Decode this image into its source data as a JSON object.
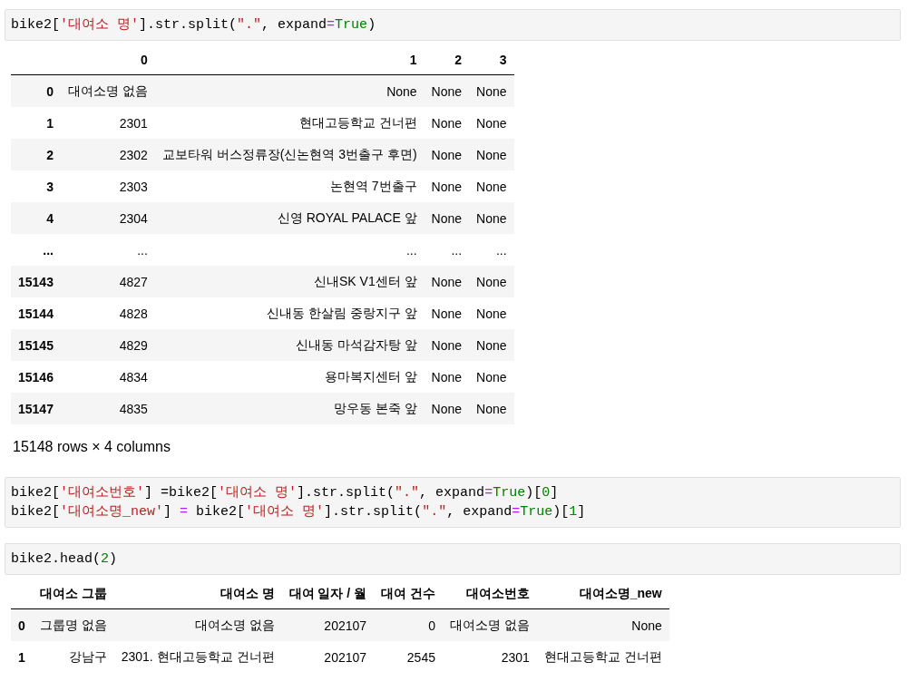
{
  "cells": [
    {
      "kind": "code",
      "lines": [
        [
          {
            "text": "bike2[",
            "kind": "plain"
          },
          {
            "text": "'대여소 명'",
            "kind": "string"
          },
          {
            "text": "].str.split(",
            "kind": "plain"
          },
          {
            "text": "\".\"",
            "kind": "string"
          },
          {
            "text": ", expand",
            "kind": "plain"
          },
          {
            "text": "=",
            "kind": "operator"
          },
          {
            "text": "True",
            "kind": "keyword"
          },
          {
            "text": ")",
            "kind": "plain"
          }
        ]
      ]
    },
    {
      "kind": "table",
      "columns": [
        "0",
        "1",
        "2",
        "3"
      ],
      "rows": [
        {
          "index": "0",
          "cells": [
            "대여소명 없음",
            "None",
            "None",
            "None"
          ]
        },
        {
          "index": "1",
          "cells": [
            "2301",
            "현대고등학교 건너편",
            "None",
            "None"
          ]
        },
        {
          "index": "2",
          "cells": [
            "2302",
            "교보타워 버스정류장(신논현역 3번출구 후면)",
            "None",
            "None"
          ]
        },
        {
          "index": "3",
          "cells": [
            "2303",
            "논현역 7번출구",
            "None",
            "None"
          ]
        },
        {
          "index": "4",
          "cells": [
            "2304",
            "신영 ROYAL PALACE 앞",
            "None",
            "None"
          ]
        },
        {
          "index": "...",
          "cells": [
            "...",
            "...",
            "...",
            "..."
          ]
        },
        {
          "index": "15143",
          "cells": [
            "4827",
            "신내SK V1센터 앞",
            "None",
            "None"
          ]
        },
        {
          "index": "15144",
          "cells": [
            "4828",
            "신내동 한살림 중랑지구 앞",
            "None",
            "None"
          ]
        },
        {
          "index": "15145",
          "cells": [
            "4829",
            "신내동 마석감자탕 앞",
            "None",
            "None"
          ]
        },
        {
          "index": "15146",
          "cells": [
            "4834",
            "용마복지센터 앞",
            "None",
            "None"
          ]
        },
        {
          "index": "15147",
          "cells": [
            "4835",
            "망우동 본죽 앞",
            "None",
            "None"
          ]
        }
      ]
    },
    {
      "kind": "text",
      "text": "15148 rows × 4 columns"
    },
    {
      "kind": "code",
      "lines": [
        [
          {
            "text": "bike2[",
            "kind": "plain"
          },
          {
            "text": "'대여소번호'",
            "kind": "string"
          },
          {
            "text": "] =bike2[",
            "kind": "plain"
          },
          {
            "text": "'대여소 명'",
            "kind": "string"
          },
          {
            "text": "].str.split(",
            "kind": "plain"
          },
          {
            "text": "\".\"",
            "kind": "string"
          },
          {
            "text": ", expand",
            "kind": "plain"
          },
          {
            "text": "=",
            "kind": "operator"
          },
          {
            "text": "True",
            "kind": "keyword"
          },
          {
            "text": ")[",
            "kind": "plain"
          },
          {
            "text": "0",
            "kind": "number"
          },
          {
            "text": "]",
            "kind": "plain"
          }
        ],
        [
          {
            "text": "bike2[",
            "kind": "plain"
          },
          {
            "text": "'대여소명_new'",
            "kind": "string"
          },
          {
            "text": "] ",
            "kind": "plain"
          },
          {
            "text": "=",
            "kind": "operator"
          },
          {
            "text": " bike2[",
            "kind": "plain"
          },
          {
            "text": "'대여소 명'",
            "kind": "string"
          },
          {
            "text": "].str.split(",
            "kind": "plain"
          },
          {
            "text": "\".\"",
            "kind": "string"
          },
          {
            "text": ", expand",
            "kind": "plain"
          },
          {
            "text": "=",
            "kind": "operator"
          },
          {
            "text": "True",
            "kind": "keyword"
          },
          {
            "text": ")[",
            "kind": "plain"
          },
          {
            "text": "1",
            "kind": "number"
          },
          {
            "text": "]",
            "kind": "plain"
          }
        ]
      ]
    },
    {
      "kind": "code",
      "lines": [
        [
          {
            "text": "bike2.head(",
            "kind": "plain"
          },
          {
            "text": "2",
            "kind": "number"
          },
          {
            "text": ")",
            "kind": "plain"
          }
        ]
      ]
    },
    {
      "kind": "table",
      "columns": [
        "대여소 그룹",
        "대여소 명",
        "대여 일자 / 월",
        "대여 건수",
        "대여소번호",
        "대여소명_new"
      ],
      "rows": [
        {
          "index": "0",
          "cells": [
            "그룹명 없음",
            "대여소명 없음",
            "202107",
            "0",
            "대여소명 없음",
            "None"
          ]
        },
        {
          "index": "1",
          "cells": [
            "강남구",
            "2301. 현대고등학교 건너편",
            "202107",
            "2545",
            "2301",
            "현대고등학교 건너편"
          ]
        }
      ]
    }
  ]
}
